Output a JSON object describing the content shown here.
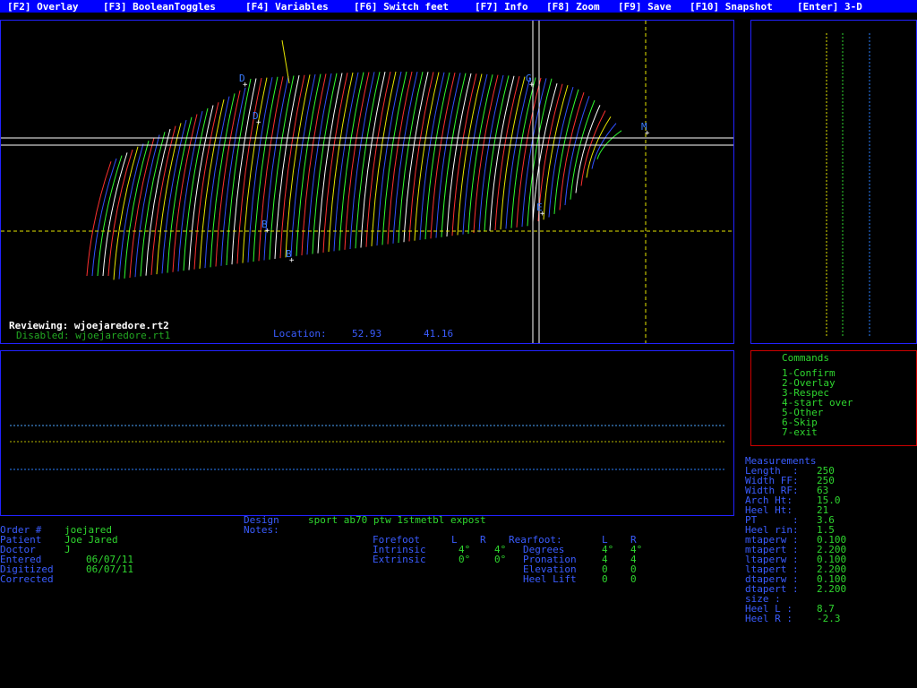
{
  "menu": {
    "f2": "[F2] Overlay",
    "f3": "[F3] BooleanToggles",
    "f4": "[F4] Variables",
    "f6": "[F6] Switch feet",
    "f7": "[F7] Info",
    "f8": "[F8] Zoom",
    "f9": "[F9] Save",
    "f10": "[F10] Snapshot",
    "enter": "[Enter] 3-D"
  },
  "scan": {
    "reviewing": "Reviewing: wjoejaredore.rt2",
    "disabled": "Disabled: wjoejaredore.rt1",
    "location_label": "Location:",
    "location_x": "52.93",
    "location_y": "41.16",
    "markers": [
      "D",
      "D",
      "G",
      "M",
      "B",
      "B",
      "E"
    ]
  },
  "commands": {
    "title": "Commands",
    "items": [
      "1-Confirm",
      "2-Overlay",
      "3-Respec",
      "4-start over",
      "5-Other",
      "6-Skip",
      "7-exit"
    ]
  },
  "measurements": {
    "title": "Measurements",
    "rows": [
      {
        "label": "Length  :",
        "value": "250"
      },
      {
        "label": "Width FF:",
        "value": "250"
      },
      {
        "label": "Width RF:",
        "value": "63"
      },
      {
        "label": "Arch Ht:",
        "value": "15.0"
      },
      {
        "label": "Heel Ht:",
        "value": "21"
      },
      {
        "label": "PT      :",
        "value": "3.6"
      },
      {
        "label": "Heel rin:",
        "value": "1.5"
      },
      {
        "label": "mtaperw :",
        "value": "0.100"
      },
      {
        "label": "mtapert :",
        "value": "2.200"
      },
      {
        "label": "ltaperw :",
        "value": "0.100"
      },
      {
        "label": "ltapert :",
        "value": "2.200"
      },
      {
        "label": "dtaperw :",
        "value": "0.100"
      },
      {
        "label": "dtapert :",
        "value": "2.200"
      },
      {
        "label": "size :",
        "value": ""
      },
      {
        "label": "Heel L :",
        "value": "8.7"
      },
      {
        "label": "Heel R :",
        "value": "-2.3"
      }
    ]
  },
  "order": {
    "rows": [
      {
        "label": "Order #",
        "value": "joejared"
      },
      {
        "label": "Patient",
        "value": "Joe Jared"
      },
      {
        "label": "Doctor",
        "value": "J"
      },
      {
        "label": "Entered",
        "value": "06/07/11"
      },
      {
        "label": "Digitized",
        "value": "06/07/11"
      },
      {
        "label": "Corrected",
        "value": ""
      }
    ]
  },
  "design": {
    "label": "Design",
    "value": "sport ab70 ptw 1stmetbl expost",
    "notes_label": "Notes:"
  },
  "posting": {
    "forefoot_label": "Forefoot",
    "rearfoot_label": "Rearfoot:",
    "col_l": "L",
    "col_r": "R",
    "forefoot": [
      {
        "label": "Intrinsic",
        "l": "4°",
        "r": "4°"
      },
      {
        "label": "Extrinsic",
        "l": "0°",
        "r": "0°"
      }
    ],
    "rearfoot": [
      {
        "label": "Degrees",
        "l": "4°",
        "r": "4°"
      },
      {
        "label": "Pronation",
        "l": "4",
        "r": "4"
      },
      {
        "label": "Elevation",
        "l": "0",
        "r": "0"
      },
      {
        "label": "Heel Lift",
        "l": "0",
        "r": "0"
      }
    ]
  },
  "colors": {
    "menubar": "#0000ff",
    "panel_border": "#2222ff",
    "command_border": "#cc0000",
    "label_blue": "#3a5cff",
    "value_green": "#2fd62f"
  }
}
